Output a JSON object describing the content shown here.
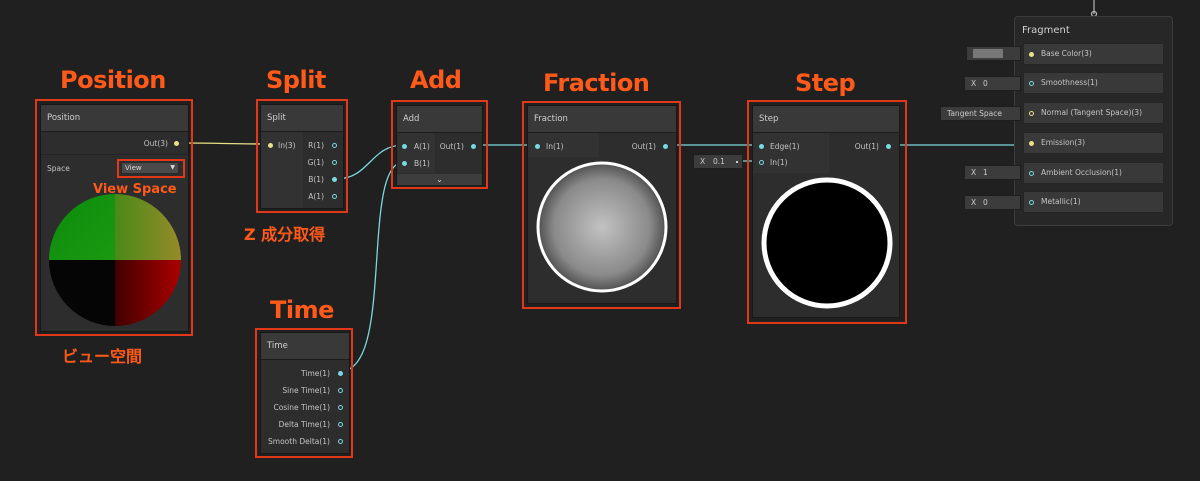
{
  "annotations": {
    "position": "Position",
    "split": "Split",
    "add": "Add",
    "fraction": "Fraction",
    "step": "Step",
    "time": "Time",
    "view_space": "View Space",
    "z_component": "Z 成分取得",
    "view_space_jp": "ビュー空間"
  },
  "nodes": {
    "position": {
      "title": "Position",
      "out": "Out(3)",
      "space_label": "Space",
      "space_value": "View"
    },
    "split": {
      "title": "Split",
      "in": "In(3)",
      "outs": [
        "R(1)",
        "G(1)",
        "B(1)",
        "A(1)"
      ]
    },
    "add": {
      "title": "Add",
      "ins": [
        "A(1)",
        "B(1)"
      ],
      "out": "Out(1)"
    },
    "fraction": {
      "title": "Fraction",
      "in": "In(1)",
      "out": "Out(1)"
    },
    "step": {
      "title": "Step",
      "ins": [
        "Edge(1)",
        "In(1)"
      ],
      "out": "Out(1)",
      "x_label": "X",
      "x_value": "0.1"
    },
    "time": {
      "title": "Time",
      "outs": [
        "Time(1)",
        "Sine Time(1)",
        "Cosine Time(1)",
        "Delta Time(1)",
        "Smooth Delta(1)"
      ]
    }
  },
  "fragment": {
    "title": "Fragment",
    "rows": [
      {
        "label": "Base Color(3)"
      },
      {
        "label": "Smoothness(1)",
        "field_prefix": "X",
        "field_value": "0"
      },
      {
        "label": "Normal (Tangent Space)(3)",
        "field_value": "Tangent Space"
      },
      {
        "label": "Emission(3)"
      },
      {
        "label": "Ambient Occlusion(1)",
        "field_prefix": "X",
        "field_value": "1"
      },
      {
        "label": "Metallic(1)",
        "field_prefix": "X",
        "field_value": "0"
      }
    ]
  },
  "colors": {
    "background": "#202020",
    "annotation": "#ff5a1a",
    "highlight_box": "#e2381a",
    "vector1_port": "#7ad8e0",
    "vector3_port": "#e8e08a"
  }
}
